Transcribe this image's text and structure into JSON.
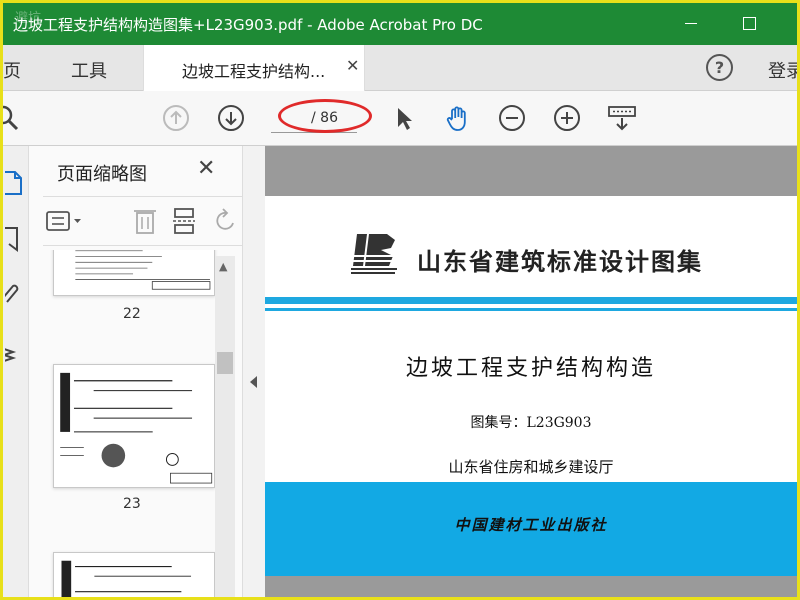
{
  "window": {
    "title": "边坡工程支护结构构造图集+L23G903.pdf - Adobe Acrobat Pro DC"
  },
  "tabs": {
    "home": "主页",
    "tools": "工具",
    "document": "边坡工程支护结构...",
    "login": "登录"
  },
  "toolbar": {
    "page_current": "",
    "page_total": "/ 86",
    "icons": [
      "search-icon",
      "prev-page-icon",
      "next-page-icon",
      "select-arrow-icon",
      "hand-tool-icon",
      "zoom-out-icon",
      "zoom-in-icon",
      "keyboard-scroll-icon"
    ]
  },
  "thumbnails": {
    "panel_title": "页面缩略图",
    "items": [
      {
        "label": "22"
      },
      {
        "label": "23"
      }
    ]
  },
  "pdf": {
    "publisher_series": "山东省建筑标准设计图集",
    "title": "边坡工程支护结构构造",
    "atlas_number": "图集号：L23G903",
    "issuer": "山东省住房和城乡建设厅",
    "press": "中国建材工业出版社"
  },
  "colors": {
    "titlebar": "#1e8a35",
    "accent_blue": "#12a9e4",
    "highlight_red": "#e02a2a",
    "frame_yellow": "#e8e01a"
  }
}
